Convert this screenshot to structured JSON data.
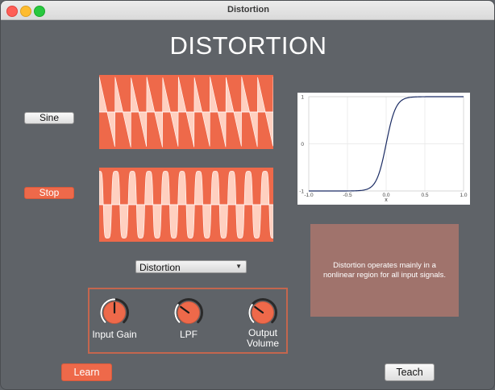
{
  "window": {
    "title": "Distortion"
  },
  "heading": "DISTORTION",
  "buttons": {
    "sine": "Sine",
    "stop": "Stop",
    "learn": "Learn",
    "teach": "Teach"
  },
  "transfer_plot": {
    "x_ticks": [
      "-1.0",
      "-0.5",
      "0.0",
      "0.5",
      "1.0"
    ],
    "y_ticks": [
      "1",
      "0",
      "-1"
    ],
    "xlabel": "x"
  },
  "effect_select": {
    "selected": "Distortion"
  },
  "info": {
    "text": "Distortion operates mainly in a nonlinear region for all input signals."
  },
  "knobs": [
    {
      "label": "Input Gain",
      "level": 0.5
    },
    {
      "label": "LPF",
      "level": 0.3
    },
    {
      "label": "Output Volume",
      "level": 0.3
    }
  ],
  "colors": {
    "accent": "#ee694a",
    "wave_fill": "#ffd0c0",
    "background": "#5f6368",
    "info_box": "#a0736c",
    "curve": "#1a2b63"
  },
  "icons": [
    "close-icon",
    "minimize-icon",
    "maximize-icon",
    "chevron-down-icon"
  ]
}
